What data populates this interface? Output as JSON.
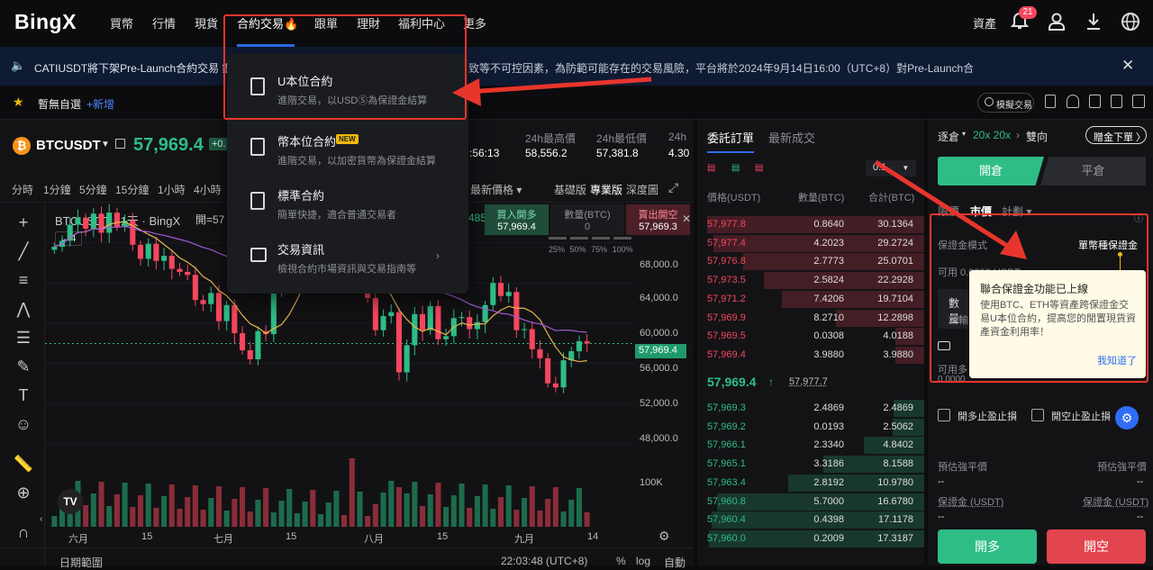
{
  "nav": {
    "logo": "BingX",
    "items": [
      "買幣",
      "行情",
      "現貨",
      "合約交易🔥",
      "跟單",
      "理財",
      "福利中心",
      "更多"
    ],
    "assets": "資產",
    "notif_count": "21"
  },
  "notice": {
    "text": "CATIUSDT將下架Pre-Launch合約交易 鑑於",
    "text2": "致等不可控因素，為防範可能存在的交易風險，平台將於2024年9月14日16:00（UTC+8）對Pre-Launch合約的CATI"
  },
  "sub": {
    "fav": "暫無自選",
    "add": "+新增",
    "demo": "模擬交易"
  },
  "ticker": {
    "symbol": "BTCUSDT",
    "price": "57,969.4",
    "change": "+0.",
    "time_partial": ":56:13",
    "high_label": "24h最高價",
    "high": "58,556.2",
    "low_label": "24h最低價",
    "low": "57,381.8",
    "vol_label": "24h",
    "vol": "4.30"
  },
  "timeframes": [
    "分時",
    "1分鐘",
    "5分鐘",
    "15分鐘",
    "1小時",
    "4小時"
  ],
  "chart_tools": {
    "latest": "最新價格 ▾",
    "basic": "基礎版",
    "pro": "專業版",
    "depth": "深度圖"
  },
  "chart": {
    "title": "BTCUSDT · 1天 · BingX",
    "open": "開=57",
    "ind_count": "4",
    "buy_label": "買入開多",
    "buy_price": "57,969.4",
    "qty_label": "數量(BTC)",
    "qty_val": "0",
    "sell_label": "賣出開空",
    "sell_price": "57,969.3",
    "pcts": [
      "25%",
      "50%",
      "75%",
      "100%"
    ],
    "partial485": "485",
    "price_ticks": [
      "68,000.0",
      "64,000.0",
      "60,000.0",
      "56,000.0",
      "52,000.0",
      "48,000.0"
    ],
    "last_price_tag": "57,969.4",
    "vol_tick": "100K",
    "x_ticks": [
      "六月",
      "15",
      "七月",
      "15",
      "八月",
      "15",
      "九月",
      "14"
    ],
    "date_range": "日期範圍",
    "clock": "22:03:48 (UTC+8)",
    "pct": "%",
    "log": "log",
    "auto": "自動"
  },
  "chart_data": {
    "type": "candlestick",
    "title": "BTCUSDT · 1天 · BingX",
    "x_ticks": [
      "六月",
      "15",
      "七月",
      "15",
      "八月",
      "15",
      "九月",
      "14"
    ],
    "ylim": [
      46000,
      72000
    ],
    "y_ticks": [
      48000,
      52000,
      56000,
      60000,
      64000,
      68000
    ],
    "last_price": 57969.4,
    "close_series": [
      67600,
      68200,
      69800,
      70500,
      69400,
      70900,
      69000,
      71000,
      69600,
      70200,
      67800,
      66400,
      67900,
      66200,
      66700,
      65400,
      65100,
      64800,
      62300,
      61900,
      63000,
      60200,
      61800,
      59000,
      57300,
      56400,
      59200,
      58900,
      63500,
      64700,
      66100,
      67600,
      68300,
      65900,
      66800,
      67300,
      68100,
      65200,
      64600,
      66100,
      62500,
      59300,
      60700,
      61100,
      55100,
      57800,
      60900,
      59300,
      61700,
      58400,
      58700,
      60500,
      60600,
      59400,
      60100,
      61800,
      64000,
      62700,
      63100,
      59300,
      59400,
      57400,
      56500,
      54000,
      53600,
      56300,
      57200,
      58200,
      57969
    ]
  },
  "orderbook": {
    "tab1": "委託訂單",
    "tab2": "最新成交",
    "step": "0.1",
    "h_price": "價格(USDT)",
    "h_qty": "數量(BTC)",
    "h_total": "合計(BTC)",
    "asks": [
      [
        "57,977.8",
        "0.8640",
        "30.1364"
      ],
      [
        "57,977.4",
        "4.2023",
        "29.2724"
      ],
      [
        "57,976.8",
        "2.7773",
        "25.0701"
      ],
      [
        "57,973.5",
        "2.5824",
        "22.2928"
      ],
      [
        "57,971.2",
        "7.4206",
        "19.7104"
      ],
      [
        "57,969.9",
        "8.2710",
        "12.2898"
      ],
      [
        "57,969.5",
        "0.0308",
        "4.0188"
      ],
      [
        "57,969.4",
        "3.9880",
        "3.9880"
      ]
    ],
    "mid_price": "57,969.4",
    "mid_arrow": "↑",
    "mark": "57,977.7",
    "bids": [
      [
        "57,969.3",
        "2.4869",
        "2.4869"
      ],
      [
        "57,969.2",
        "0.0193",
        "2.5062"
      ],
      [
        "57,966.1",
        "2.3340",
        "4.8402"
      ],
      [
        "57,965.1",
        "3.3186",
        "8.1588"
      ],
      [
        "57,963.4",
        "2.8192",
        "10.9780"
      ],
      [
        "57,960.8",
        "5.7000",
        "16.6780"
      ],
      [
        "57,960.4",
        "0.4398",
        "17.1178"
      ],
      [
        "57,960.0",
        "0.2009",
        "17.3187"
      ]
    ]
  },
  "trade": {
    "mode": "逐倉",
    "lev": "20x 20x",
    "dir": "雙向",
    "gift": "贈金下單 〉",
    "open": "開倉",
    "close": "平倉",
    "tabs": [
      "限價",
      "市價",
      "計劃 ▾"
    ],
    "margin_mode_label": "保證金模式",
    "margin_mode": "單幣種保證金",
    "avail": "可用 0.0000 USDT",
    "qty": "數量",
    "qty_ph": "請輸",
    "avail2": "可用多",
    "zero": "0.0000",
    "tp_long": "開多止盈止損",
    "tp_short": "開空止盈止損",
    "liq_l": "預估強平價",
    "liq_r": "預估強平價",
    "dash": "--",
    "margin_l": "保證金 (USDT)",
    "margin_r": "保證金 (USDT)",
    "long": "開多",
    "short": "開空"
  },
  "tip": {
    "title": "聯合保證金功能已上線",
    "body": "使用BTC、ETH等資產跨保證金交易U本位合約，提高您的閒置現貨資產資金利用率！",
    "ok": "我知道了"
  },
  "menu": {
    "items": [
      {
        "title": "U本位合約",
        "desc": "進階交易，以USDⓈ為保證金結算"
      },
      {
        "title": "幣本位合約",
        "desc": "進階交易，以加密貨幣為保證金結算",
        "badge": "NEW"
      },
      {
        "title": "標準合約",
        "desc": "簡單快捷，適合普通交易者"
      },
      {
        "title": "交易資訊",
        "desc": "檢視合約市場資訊與交易指南等"
      }
    ]
  },
  "colors": {
    "up": "#2ebd85",
    "down": "#f6465d",
    "accent": "#2f6df6",
    "highlight": "#e8352c"
  }
}
